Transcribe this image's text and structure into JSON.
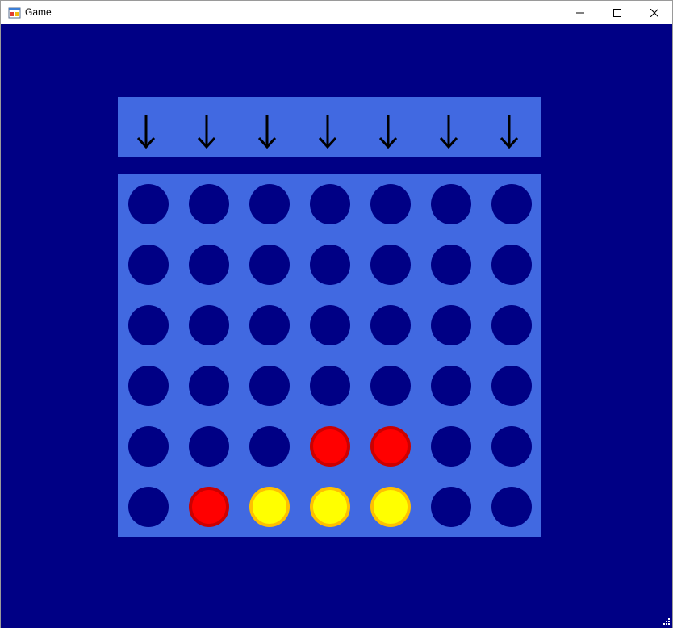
{
  "window": {
    "title": "Game",
    "icon": "app-window-icon",
    "controls": [
      "minimize-icon",
      "maximize-icon",
      "close-icon"
    ]
  },
  "colors": {
    "background": "#000085",
    "board": "#4169e1",
    "empty_slot": "#000085",
    "red": "#ff0000",
    "red_rim": "#cc0000",
    "yellow": "#ffff00",
    "yellow_rim": "#ffc000",
    "arrow": "#000000"
  },
  "board": {
    "columns": 7,
    "rows": 6,
    "drop_arrows": [
      "↓",
      "↓",
      "↓",
      "↓",
      "↓",
      "↓",
      "↓"
    ],
    "cells": [
      [
        "empty",
        "empty",
        "empty",
        "empty",
        "empty",
        "empty",
        "empty"
      ],
      [
        "empty",
        "empty",
        "empty",
        "empty",
        "empty",
        "empty",
        "empty"
      ],
      [
        "empty",
        "empty",
        "empty",
        "empty",
        "empty",
        "empty",
        "empty"
      ],
      [
        "empty",
        "empty",
        "empty",
        "empty",
        "empty",
        "empty",
        "empty"
      ],
      [
        "empty",
        "empty",
        "empty",
        "red",
        "red",
        "empty",
        "empty"
      ],
      [
        "empty",
        "red",
        "yellow",
        "yellow",
        "yellow",
        "empty",
        "empty"
      ]
    ]
  }
}
